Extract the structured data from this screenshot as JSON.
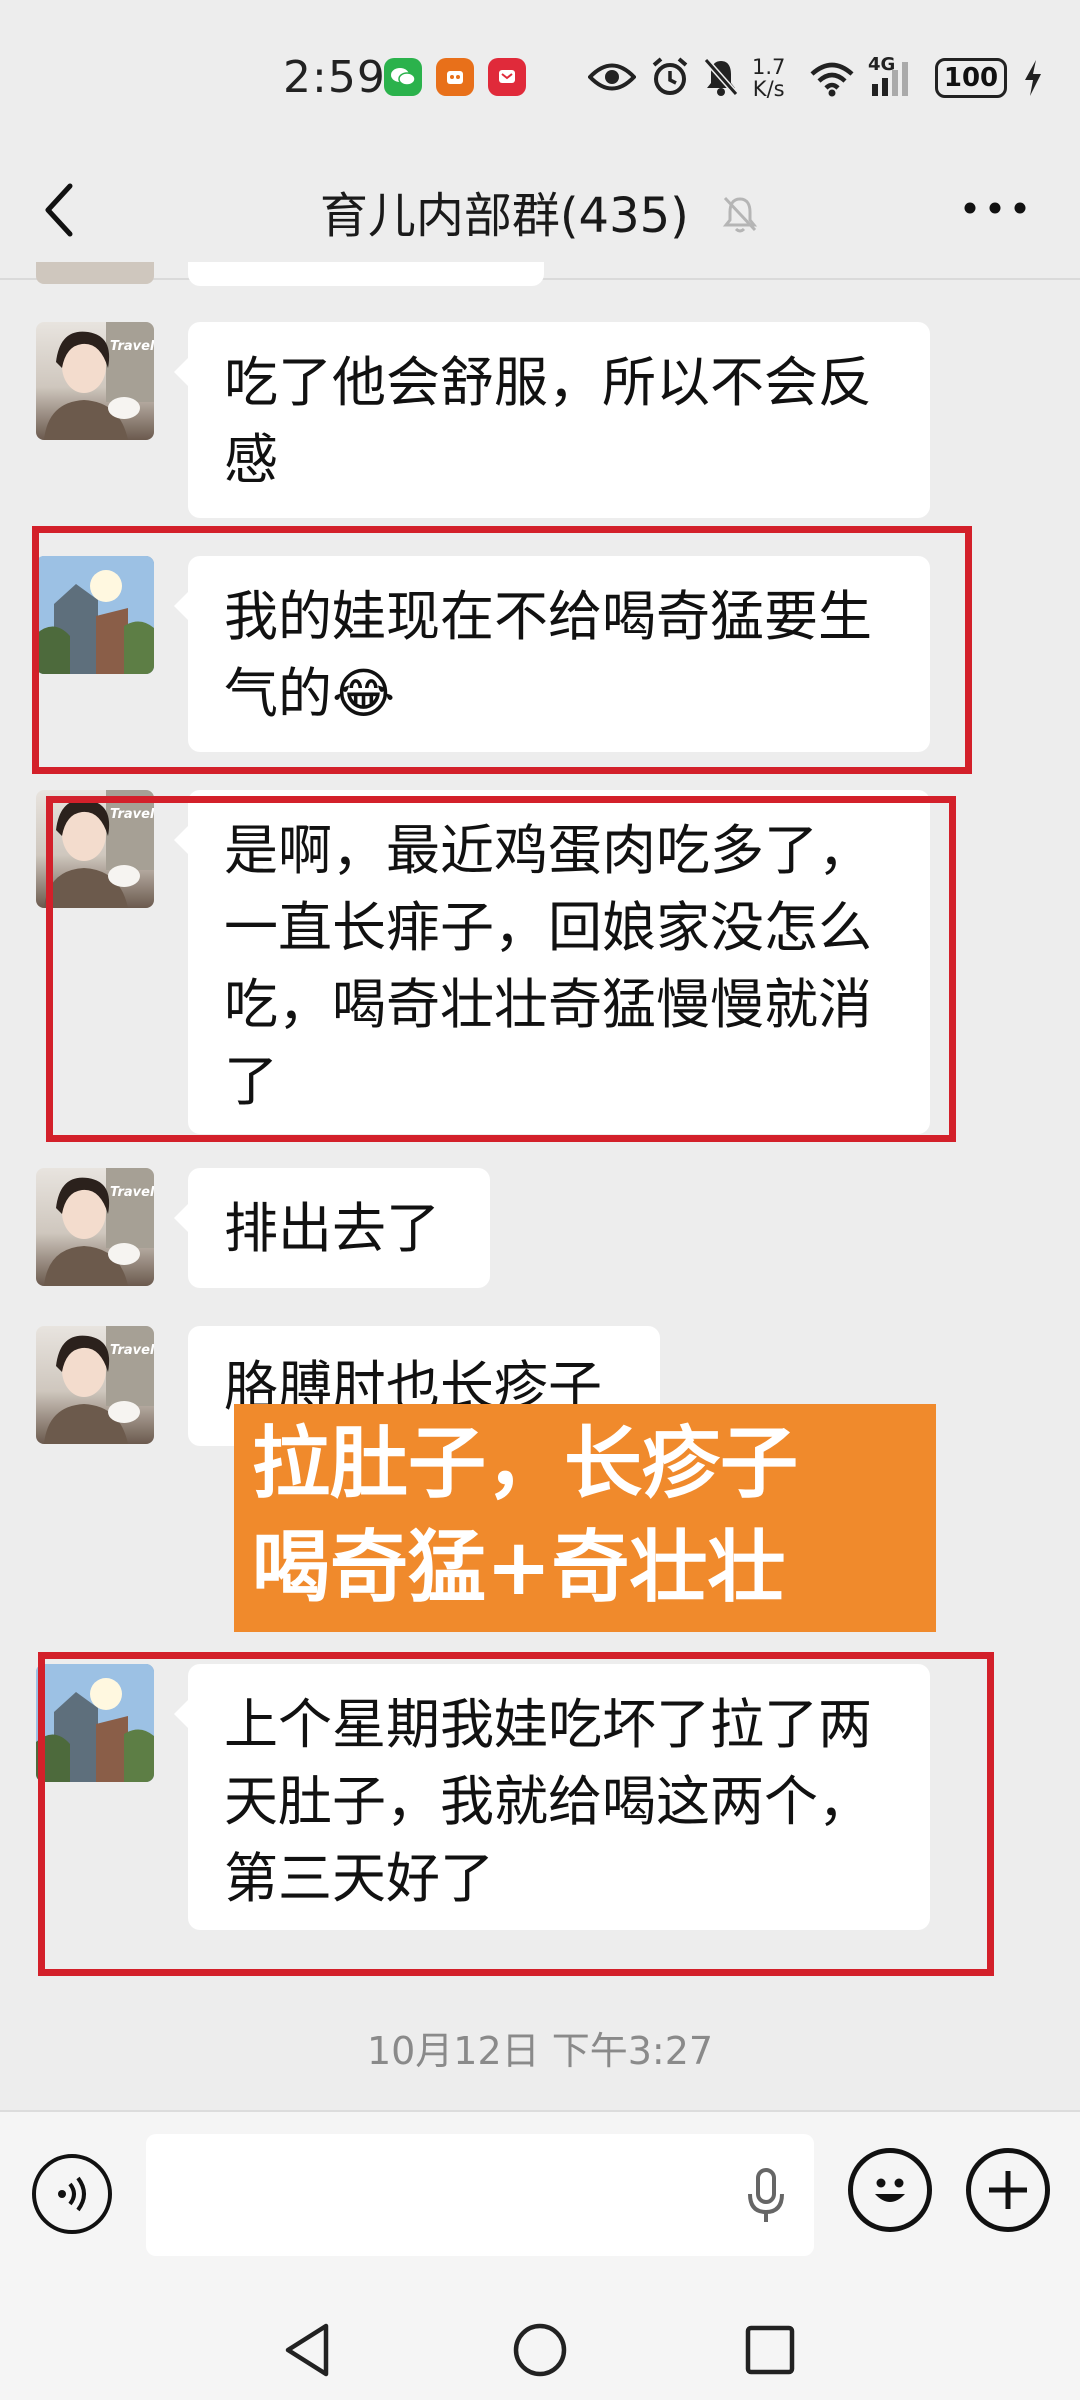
{
  "status_bar": {
    "time": "2:59",
    "network_speed_value": "1.7",
    "network_speed_unit": "K/s",
    "network_type": "4G",
    "battery": "100"
  },
  "header": {
    "title": "育儿内部群(435)",
    "back_icon": "chevron-left-icon",
    "mute_icon": "bell-muted-icon",
    "more_icon": "more-horizontal-icon"
  },
  "messages": [
    {
      "avatar": "woman-avatar",
      "text_lines": [
        "吃了他会舒服，所以不会反",
        "感"
      ]
    },
    {
      "avatar": "building-avatar",
      "text_lines": [
        "我的娃现在不给喝奇猛要生",
        "气的😂"
      ]
    },
    {
      "avatar": "woman-avatar",
      "text_lines": [
        "是啊，最近鸡蛋肉吃多了，",
        "一直长痱子，回娘家没怎么",
        "吃，喝奇壮壮奇猛慢慢就消",
        "了"
      ]
    },
    {
      "avatar": "woman-avatar",
      "text_lines": [
        "排出去了"
      ]
    },
    {
      "avatar": "woman-avatar",
      "text_lines": [
        "胳膊肘也长疹子"
      ]
    },
    {
      "avatar": "building-avatar",
      "text_lines": [
        "上个星期我娃吃坏了拉了两",
        "天肚子，我就给喝这两个，",
        "第三天好了"
      ]
    }
  ],
  "overlay": {
    "line1": "拉肚子，长疹子",
    "line2": "喝奇猛+奇壮壮"
  },
  "timestamp": "10月12日 下午3:27",
  "colors": {
    "background": "#ededed",
    "bubble": "#ffffff",
    "highlight_box": "#d3202a",
    "overlay_banner": "#f08a2c"
  },
  "input_bar": {
    "voice_icon": "voice-input-icon",
    "mic_icon": "microphone-icon",
    "emoji_icon": "emoji-icon",
    "plus_icon": "plus-icon"
  }
}
